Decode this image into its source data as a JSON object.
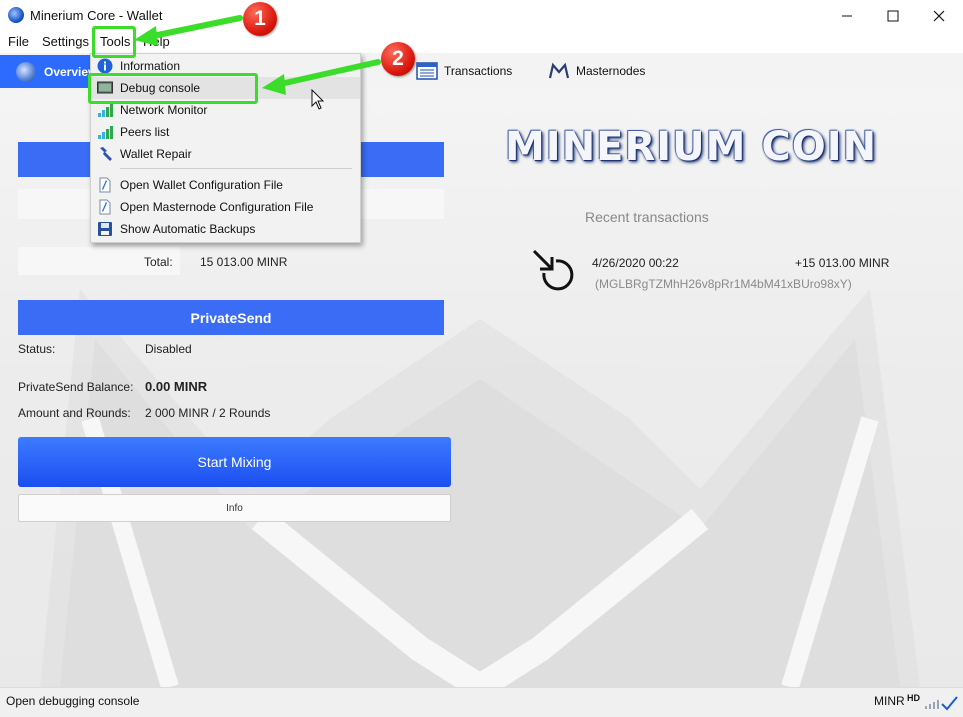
{
  "window": {
    "title": "Minerium Core - Wallet",
    "min": "—",
    "max": "☐",
    "close": "✕"
  },
  "menubar": {
    "file": "File",
    "settings": "Settings",
    "tools": "Tools",
    "help": "Help"
  },
  "toolbar": {
    "overview": "Overview",
    "transactions": "Transactions",
    "masternodes": "Masternodes"
  },
  "balances": {
    "total_label": "Total:",
    "total_value": "15 013.00 MINR"
  },
  "privatesend": {
    "header": "PrivateSend",
    "status_label": "Status:",
    "status_value": "Disabled",
    "balance_label": "PrivateSend Balance:",
    "balance_value": "0.00 MINR",
    "amount_label": "Amount and Rounds:",
    "amount_value": "2 000 MINR / 2 Rounds",
    "start_button": "Start Mixing",
    "info_button": "Info"
  },
  "brand": "MINERIUM COIN",
  "recent": {
    "title": "Recent transactions",
    "items": [
      {
        "date": "4/26/2020 00:22",
        "amount": "+15 013.00 MINR",
        "address": "(MGLBRgTZMhH26v8pRr1M4bM41xBUro98xY)"
      }
    ]
  },
  "tools_menu": {
    "items": [
      {
        "label": "Information",
        "icon": "info-icon"
      },
      {
        "label": "Debug console",
        "icon": "console-icon"
      },
      {
        "label": "Network Monitor",
        "icon": "network-icon"
      },
      {
        "label": "Peers list",
        "icon": "peers-icon"
      },
      {
        "label": "Wallet Repair",
        "icon": "wrench-icon"
      },
      {
        "label": "Open Wallet Configuration File",
        "icon": "file-icon"
      },
      {
        "label": "Open Masternode Configuration File",
        "icon": "file-icon"
      },
      {
        "label": "Show Automatic Backups",
        "icon": "floppy-icon"
      }
    ]
  },
  "annotations": {
    "step1": "1",
    "step2": "2"
  },
  "statusbar": {
    "text": "Open debugging console",
    "unit": "MINR",
    "hd": "HD"
  },
  "colors": {
    "accent": "#2d6bff",
    "highlight": "#3cdc2a",
    "badge": "#d8140a"
  }
}
